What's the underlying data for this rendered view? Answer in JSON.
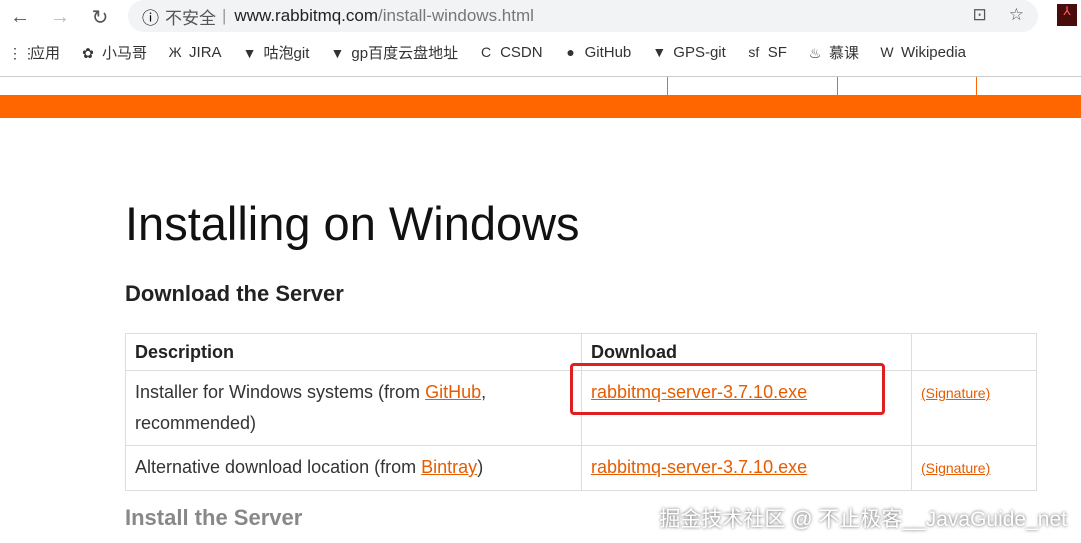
{
  "browser": {
    "url_warning": "不安全",
    "url_host": "www.rabbitmq.com",
    "url_path": "/install-windows.html"
  },
  "bookmarks": [
    {
      "icon": "apps-icon",
      "glyph": "⋮⋮",
      "label": "应用"
    },
    {
      "icon": "baidu-icon",
      "glyph": "✿",
      "label": "小马哥"
    },
    {
      "icon": "jira-icon",
      "glyph": "Ж",
      "label": "JIRA"
    },
    {
      "icon": "gitlab-icon",
      "glyph": "▼",
      "label": "咕泡git"
    },
    {
      "icon": "gitlab-icon",
      "glyph": "▼",
      "label": "gp百度云盘地址"
    },
    {
      "icon": "csdn-icon",
      "glyph": "C",
      "label": "CSDN"
    },
    {
      "icon": "github-icon",
      "glyph": "●",
      "label": "GitHub"
    },
    {
      "icon": "gitlab-icon",
      "glyph": "▼",
      "label": "GPS-git"
    },
    {
      "icon": "sf-icon",
      "glyph": "sf",
      "label": "SF"
    },
    {
      "icon": "imooc-icon",
      "glyph": "♨",
      "label": "慕课"
    },
    {
      "icon": "wikipedia-icon",
      "glyph": "W",
      "label": "Wikipedia"
    }
  ],
  "page": {
    "title": "Installing on Windows",
    "section1": "Download the Server",
    "table": {
      "headers": [
        "Description",
        "Download",
        ""
      ],
      "rows": [
        {
          "desc": "Installer for Windows systems (from ",
          "link": "GitHub",
          "desc_end": ", recommended)",
          "file": "rabbitmq-server-3.7.10.exe",
          "sig": "(Signature)"
        },
        {
          "desc": "Alternative download location (from ",
          "link": "Bintray",
          "desc_end": ")",
          "file": "rabbitmq-server-3.7.10.exe",
          "sig": "(Signature)"
        }
      ]
    },
    "section2": "Install the Server"
  },
  "watermark": "掘金技术社区 @ 不止极客__JavaGuide_net"
}
